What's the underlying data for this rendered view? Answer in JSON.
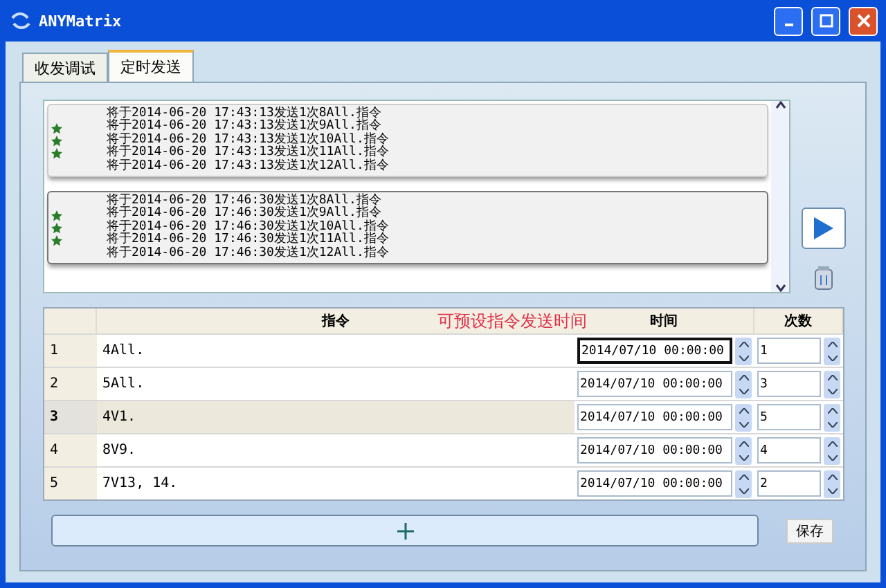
{
  "window": {
    "title": "ANYMatrix"
  },
  "tabs": [
    {
      "label": "收发调试",
      "selected": false
    },
    {
      "label": "定时发送",
      "selected": true
    }
  ],
  "log_groups": [
    {
      "lines": [
        "将于2014-06-20 17:43:13发送1次8All.指令",
        "将于2014-06-20 17:43:13发送1次9All.指令",
        "将于2014-06-20 17:43:13发送1次10All.指令",
        "将于2014-06-20 17:43:13发送1次11All.指令",
        "将于2014-06-20 17:43:13发送1次12All.指令"
      ],
      "selected": false
    },
    {
      "lines": [
        "将于2014-06-20 17:46:30发送1次8All.指令",
        "将于2014-06-20 17:46:30发送1次9All.指令",
        "将于2014-06-20 17:46:30发送1次10All.指令",
        "将于2014-06-20 17:46:30发送1次11All.指令",
        "将于2014-06-20 17:46:30发送1次12All.指令"
      ],
      "selected": true
    }
  ],
  "annotation": "可预设指令发送时间",
  "table": {
    "columns": [
      "指令",
      "时间",
      "次数"
    ],
    "rows": [
      {
        "index": "1",
        "command": "4All.",
        "time": "2014/07/10 00:00:00",
        "count": "1",
        "selected": false,
        "focused": true
      },
      {
        "index": "2",
        "command": "5All.",
        "time": "2014/07/10 00:00:00",
        "count": "3",
        "selected": false,
        "focused": false
      },
      {
        "index": "3",
        "command": "4V1.",
        "time": "2014/07/10 00:00:00",
        "count": "5",
        "selected": true,
        "focused": false
      },
      {
        "index": "4",
        "command": "8V9.",
        "time": "2014/07/10 00:00:00",
        "count": "4",
        "selected": false,
        "focused": false
      },
      {
        "index": "5",
        "command": "7V13, 14.",
        "time": "2014/07/10 00:00:00",
        "count": "2",
        "selected": false,
        "focused": false
      }
    ]
  },
  "save_button": "保存"
}
